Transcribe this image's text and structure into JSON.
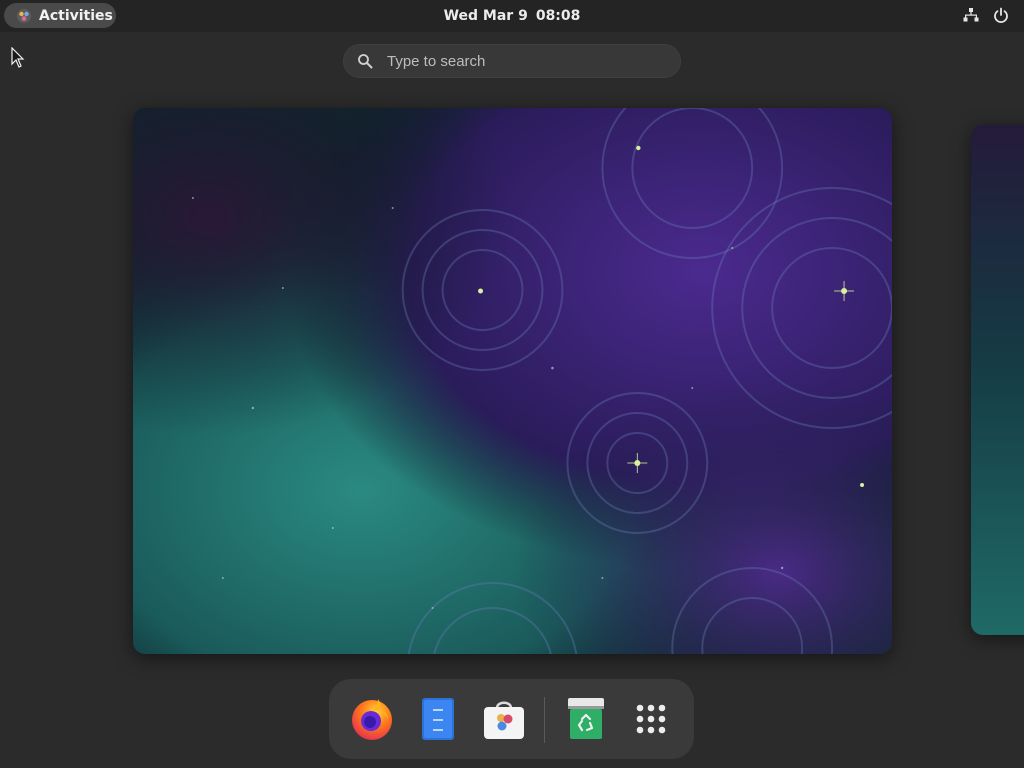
{
  "topbar": {
    "activities_label": "Activities",
    "clock": {
      "day": "Wed Mar 9",
      "time": "08:08"
    },
    "tray_icons": [
      "network-wired-icon",
      "power-icon"
    ]
  },
  "search": {
    "placeholder": "Type to search",
    "value": ""
  },
  "workspaces": [
    {
      "name": "workspace-1",
      "wallpaper": "cosmic nebula with swirling circles"
    },
    {
      "name": "workspace-2",
      "wallpaper": "cosmic nebula with swirling circles"
    }
  ],
  "dock": {
    "items": [
      {
        "id": "firefox",
        "icon": "firefox-icon"
      },
      {
        "id": "files",
        "icon": "files-icon"
      },
      {
        "id": "software",
        "icon": "software-store-icon"
      },
      {
        "id": "trash",
        "icon": "trash-icon"
      },
      {
        "id": "show-apps",
        "icon": "app-grid-icon"
      }
    ]
  },
  "colors": {
    "topbar_bg": "#242424",
    "overview_bg": "#2b2b2b",
    "dock_bg": "#3a3a3a",
    "search_bg": "#383838",
    "nebula_teal": "#1f6f6a",
    "nebula_purple": "#4a2a8a"
  }
}
